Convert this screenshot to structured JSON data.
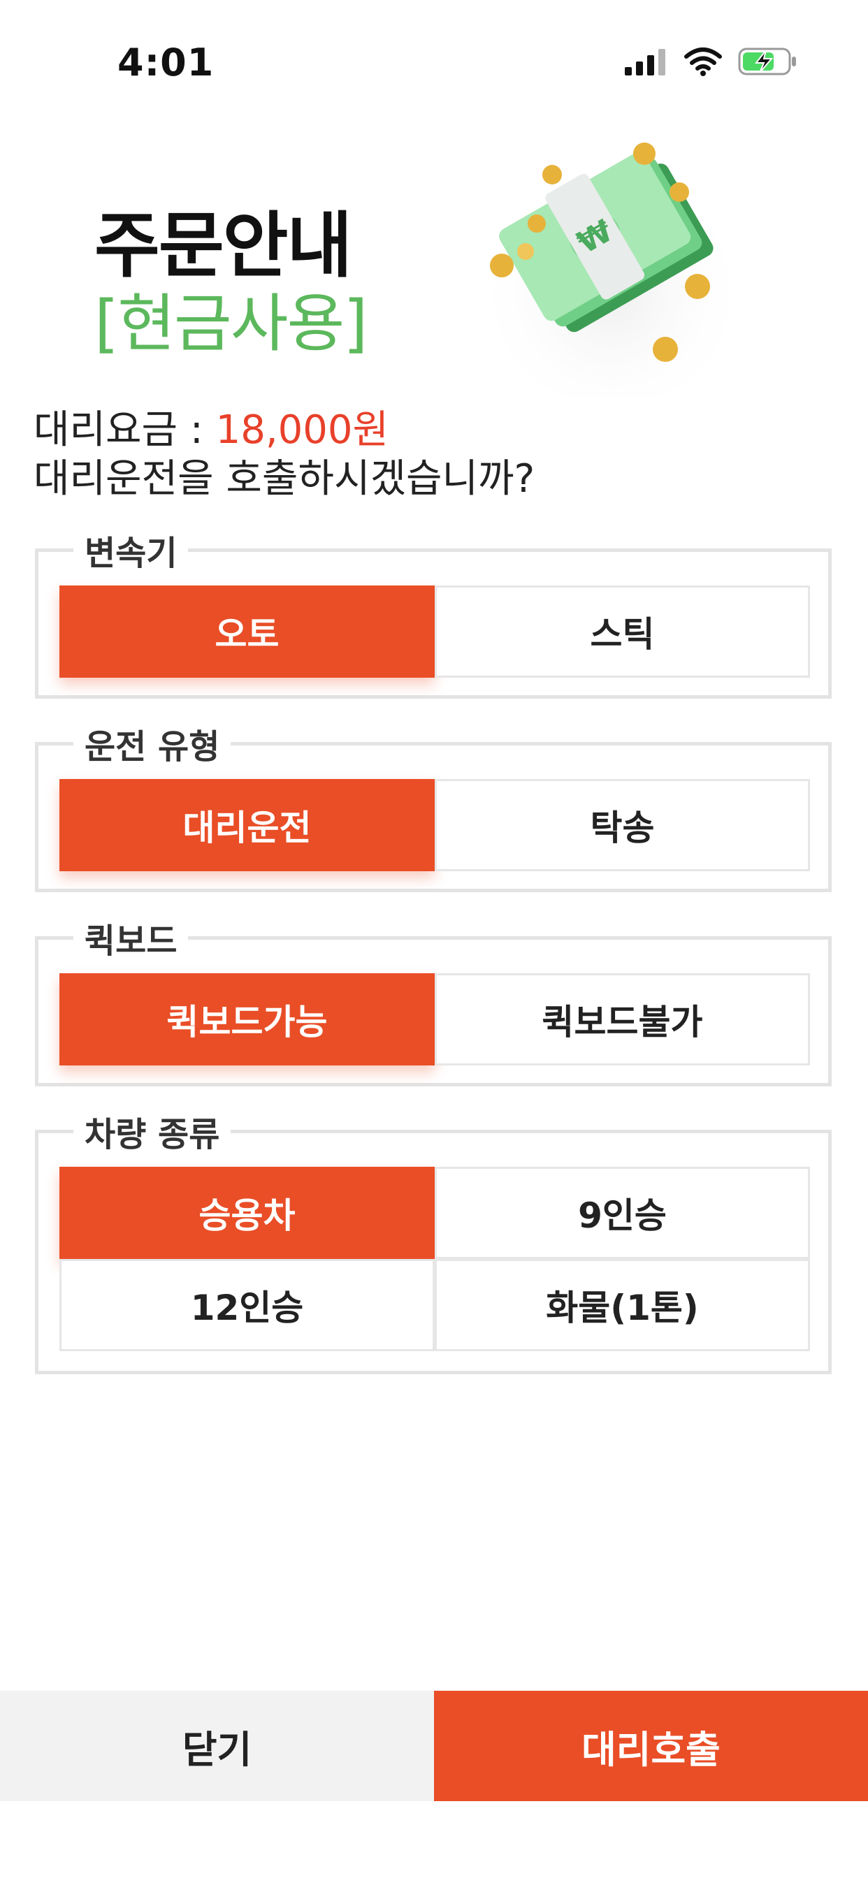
{
  "status": {
    "time": "4:01"
  },
  "header": {
    "title": "주문안내",
    "subtitle": "[현금사용]",
    "illustration": "cash-bundle-with-coins"
  },
  "fare": {
    "label": "대리요금 : ",
    "value": "18,000원"
  },
  "question": "대리운전을 호출하시겠습니까?",
  "groups": {
    "transmission": {
      "legend": "변속기",
      "options": [
        "오토",
        "스틱"
      ],
      "selected": "오토"
    },
    "drive_type": {
      "legend": "운전 유형",
      "options": [
        "대리운전",
        "탁송"
      ],
      "selected": "대리운전"
    },
    "kickboard": {
      "legend": "퀵보드",
      "options": [
        "퀵보드가능",
        "퀵보드불가"
      ],
      "selected": "퀵보드가능"
    },
    "vehicle_type": {
      "legend": "차량 종류",
      "options": [
        "승용차",
        "9인승",
        "12인승",
        "화물(1톤)"
      ],
      "selected": "승용차"
    }
  },
  "bottom": {
    "close_label": "닫기",
    "call_label": "대리호출"
  },
  "colors": {
    "accent": "#e94e27",
    "green": "#5cb85c",
    "fare_red": "#e8402a"
  }
}
